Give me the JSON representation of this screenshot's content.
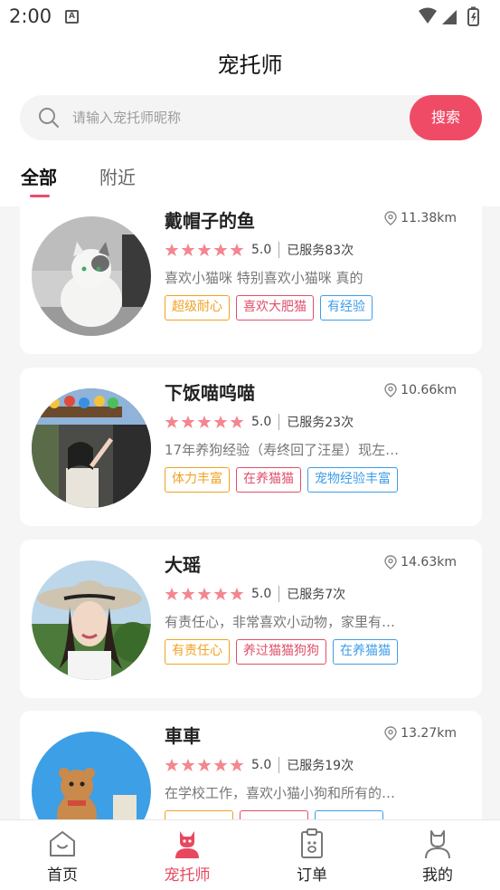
{
  "status_bar": {
    "time": "2:00",
    "notification_icon": "A"
  },
  "header": {
    "title": "宠托师"
  },
  "search": {
    "placeholder": "请输入宠托师昵称",
    "button_label": "搜索"
  },
  "tabs": [
    {
      "label": "全部",
      "active": true
    },
    {
      "label": "附近",
      "active": false
    }
  ],
  "sitters": [
    {
      "name": "戴帽子的鱼",
      "distance": "11.38km",
      "rating": "5.0",
      "served": "已服务83次",
      "desc": "喜欢小猫咪 特别喜欢小猫咪 真的",
      "tags": [
        "超级耐心",
        "喜欢大肥猫",
        "有经验"
      ]
    },
    {
      "name": "下饭喵呜喵",
      "distance": "10.66km",
      "rating": "5.0",
      "served": "已服务23次",
      "desc": "17年养狗经验（寿终回了汪星）现左…",
      "tags": [
        "体力丰富",
        "在养猫猫",
        "宠物经验丰富"
      ]
    },
    {
      "name": "大瑶",
      "distance": "14.63km",
      "rating": "5.0",
      "served": "已服务7次",
      "desc": "有责任心，非常喜欢小动物，家里有…",
      "tags": [
        "有责任心",
        "养过猫猫狗狗",
        "在养猫猫"
      ]
    },
    {
      "name": "車車",
      "distance": "13.27km",
      "rating": "5.0",
      "served": "已服务19次",
      "desc": "在学校工作，喜欢小猫小狗和所有的…",
      "tags": [
        "",
        "",
        ""
      ]
    }
  ],
  "bottom_nav": [
    {
      "label": "首页",
      "icon": "home-icon",
      "active": false
    },
    {
      "label": "宠托师",
      "icon": "sitter-icon",
      "active": true
    },
    {
      "label": "订单",
      "icon": "order-icon",
      "active": false
    },
    {
      "label": "我的",
      "icon": "profile-icon",
      "active": false
    }
  ],
  "colors": {
    "accent": "#f04b66",
    "star": "#f4868f",
    "tag_yellow": "#efa323",
    "tag_red": "#e0506a",
    "tag_blue": "#3f9de8"
  }
}
